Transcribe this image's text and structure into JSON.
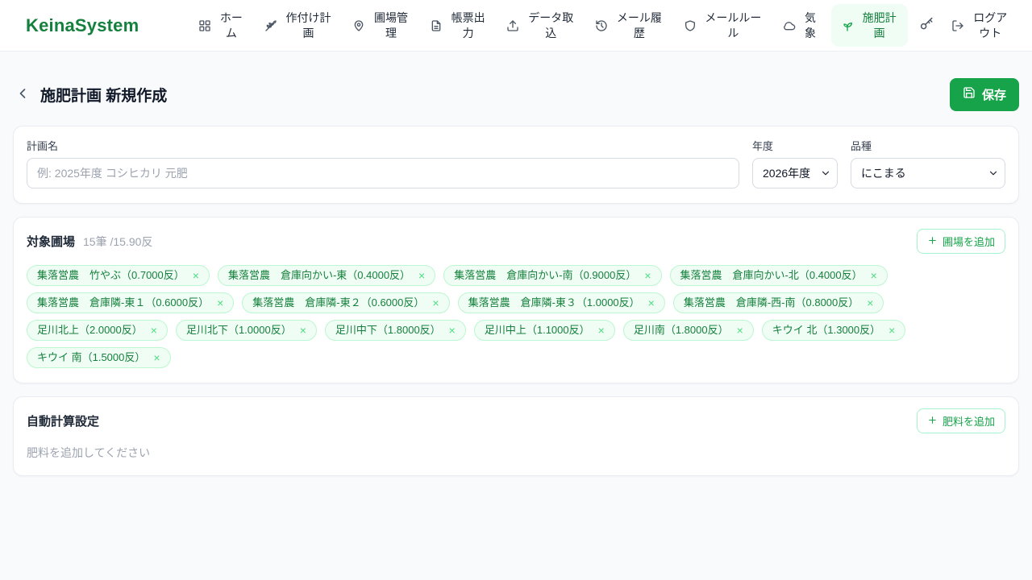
{
  "header": {
    "logo": "KeinaSystem",
    "nav": [
      {
        "label": "ホーム",
        "icon": "grid-icon"
      },
      {
        "label": "作付け計画",
        "icon": "wheat-icon"
      },
      {
        "label": "圃場管理",
        "icon": "map-pin-icon"
      },
      {
        "label": "帳票出力",
        "icon": "document-icon"
      },
      {
        "label": "データ取込",
        "icon": "upload-icon"
      },
      {
        "label": "メール履歴",
        "icon": "history-icon"
      },
      {
        "label": "メールルール",
        "icon": "shield-icon"
      },
      {
        "label": "気象",
        "icon": "cloud-icon"
      },
      {
        "label": "施肥計画",
        "icon": "sprout-icon",
        "active": true
      }
    ],
    "logout_label": "ログアウト"
  },
  "page": {
    "title": "施肥計画 新規作成",
    "save_label": "保存"
  },
  "plan_form": {
    "name_label": "計画名",
    "name_placeholder": "例: 2025年度 コシヒカリ 元肥",
    "year_label": "年度",
    "year_value": "2026年度",
    "variety_label": "品種",
    "variety_value": "にこまる"
  },
  "fields_section": {
    "title": "対象圃場",
    "count_summary": "15筆 /15.90反",
    "add_button_label": "圃場を追加",
    "remove_glyph": "×",
    "tags": [
      {
        "label": "集落営農　竹やぶ（0.7000反）"
      },
      {
        "label": "集落営農　倉庫向かい-東（0.4000反）"
      },
      {
        "label": "集落営農　倉庫向かい-南（0.9000反）"
      },
      {
        "label": "集落営農　倉庫向かい-北（0.4000反）"
      },
      {
        "label": "集落営農　倉庫隣-東１（0.6000反）"
      },
      {
        "label": "集落営農　倉庫隣-東２（0.6000反）"
      },
      {
        "label": "集落営農　倉庫隣-東３（1.0000反）"
      },
      {
        "label": "集落営農　倉庫隣-西-南（0.8000反）"
      },
      {
        "label": "足川北上（2.0000反）"
      },
      {
        "label": "足川北下（1.0000反）"
      },
      {
        "label": "足川中下（1.8000反）"
      },
      {
        "label": "足川中上（1.1000反）"
      },
      {
        "label": "足川南（1.8000反）"
      },
      {
        "label": "キウイ 北（1.3000反）"
      },
      {
        "label": "キウイ 南（1.5000反）"
      }
    ]
  },
  "fertilizer_section": {
    "title": "自動計算設定",
    "add_button_label": "肥料を追加",
    "empty_text": "肥料を追加してください"
  },
  "colors": {
    "accent_green": "#16a34a",
    "logo_green": "#15803d",
    "active_nav_bg": "#f0fdf4",
    "tag_bg": "#f0fdf4",
    "tag_border": "#bbf7d0",
    "tag_text": "#15803d",
    "page_bg": "#f8fafc",
    "header_bg": "#ffffff"
  }
}
